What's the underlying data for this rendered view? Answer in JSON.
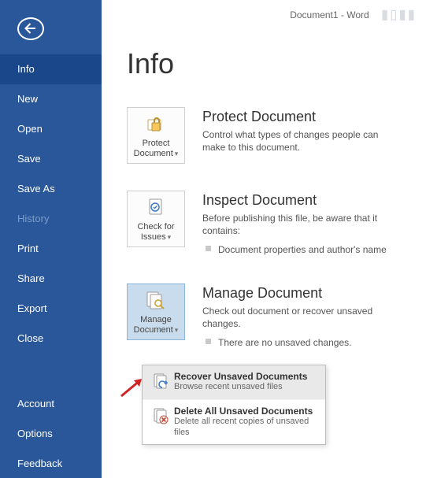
{
  "window": {
    "title": "Document1 - Word"
  },
  "sidebar": {
    "items": [
      {
        "label": "Info",
        "selected": true
      },
      {
        "label": "New"
      },
      {
        "label": "Open"
      },
      {
        "label": "Save"
      },
      {
        "label": "Save As"
      },
      {
        "label": "History",
        "disabled": true
      },
      {
        "label": "Print"
      },
      {
        "label": "Share"
      },
      {
        "label": "Export"
      },
      {
        "label": "Close"
      }
    ],
    "footer": [
      {
        "label": "Account"
      },
      {
        "label": "Options"
      },
      {
        "label": "Feedback"
      }
    ]
  },
  "page": {
    "title": "Info",
    "sections": [
      {
        "tile_label": "Protect Document",
        "heading": "Protect Document",
        "desc": "Control what types of changes people can make to this document."
      },
      {
        "tile_label": "Check for Issues",
        "heading": "Inspect Document",
        "desc": "Before publishing this file, be aware that it contains:",
        "bullet": "Document properties and author's name"
      },
      {
        "tile_label": "Manage Document",
        "heading": "Manage Document",
        "desc": "Check out document or recover unsaved changes.",
        "bullet": "There are no unsaved changes."
      }
    ]
  },
  "dropdown": {
    "items": [
      {
        "title": "Recover Unsaved Documents",
        "desc": "Browse recent unsaved files"
      },
      {
        "title": "Delete All Unsaved Documents",
        "desc": "Delete all recent copies of unsaved files"
      }
    ]
  }
}
